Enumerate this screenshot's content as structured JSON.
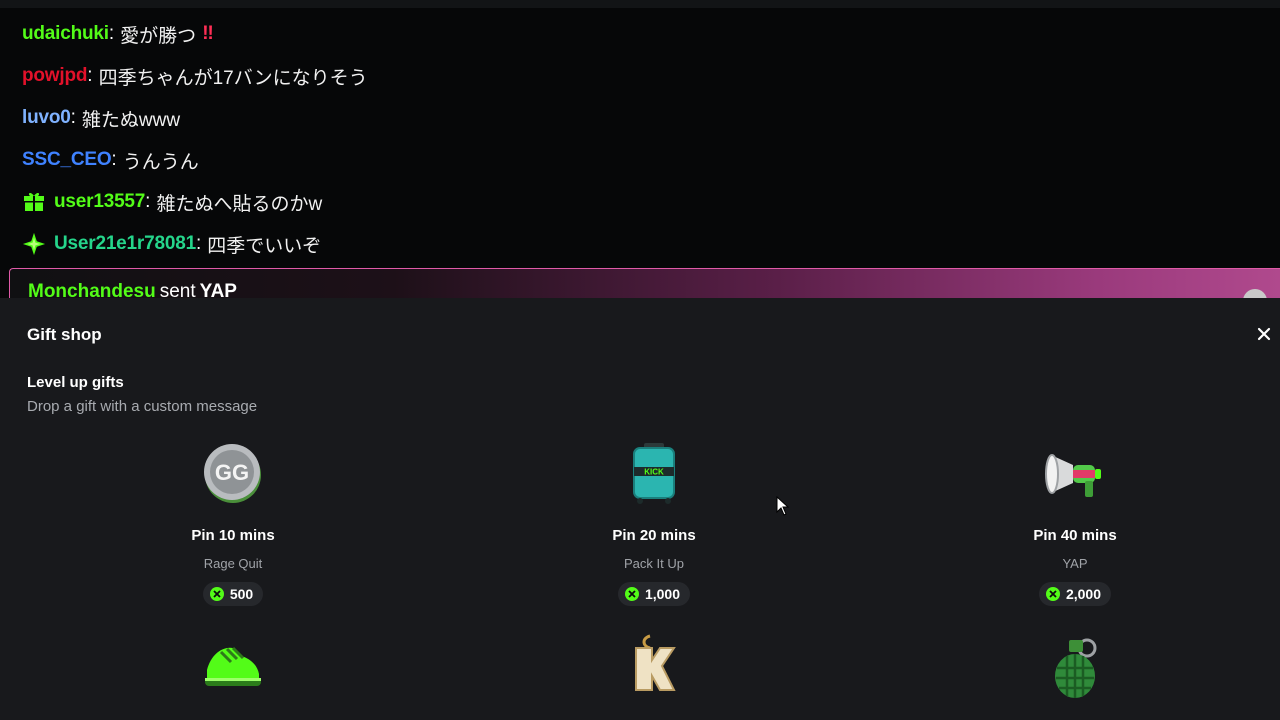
{
  "chat": {
    "messages": [
      {
        "user": "udaichuki",
        "user_color": "#53fc18",
        "text": "愛が勝つ",
        "alert": "‼"
      },
      {
        "user": "powjpd",
        "user_color": "#e2112a",
        "text": "四季ちゃんが17バンになりそう"
      },
      {
        "user": "luvo0",
        "user_color": "#7fb2ff",
        "text": "雑たぬwww"
      },
      {
        "user": "SSC_CEO",
        "user_color": "#3f82ff",
        "text": "うんうん"
      },
      {
        "user": "user13557",
        "user_color": "#53fc18",
        "text": "雑たぬへ貼るのかw",
        "badge": "gift-badge-icon"
      },
      {
        "user": "User21e1r78081",
        "user_color": "#25d58b",
        "text": "四季でいいぞ",
        "badge": "sparkle-badge-icon"
      }
    ],
    "gift_banner": {
      "user": "Monchandesu",
      "sent": "sent",
      "item": "YAP"
    }
  },
  "shop": {
    "title": "Gift shop",
    "close_icon": "close-icon",
    "section_title": "Level up gifts",
    "section_subtitle": "Drop a gift with a custom message",
    "accent_color": "#53fc18",
    "gifts": [
      {
        "pin": "Pin 10 mins",
        "name": "Rage Quit",
        "price": "500",
        "icon": "gg-coin-icon"
      },
      {
        "pin": "Pin 20 mins",
        "name": "Pack It Up",
        "price": "1,000",
        "icon": "suitcase-icon"
      },
      {
        "pin": "Pin 40 mins",
        "name": "YAP",
        "price": "2,000",
        "icon": "megaphone-icon"
      },
      {
        "icon": "sneaker-icon"
      },
      {
        "icon": "k-chain-icon"
      },
      {
        "icon": "grenade-icon"
      }
    ]
  }
}
